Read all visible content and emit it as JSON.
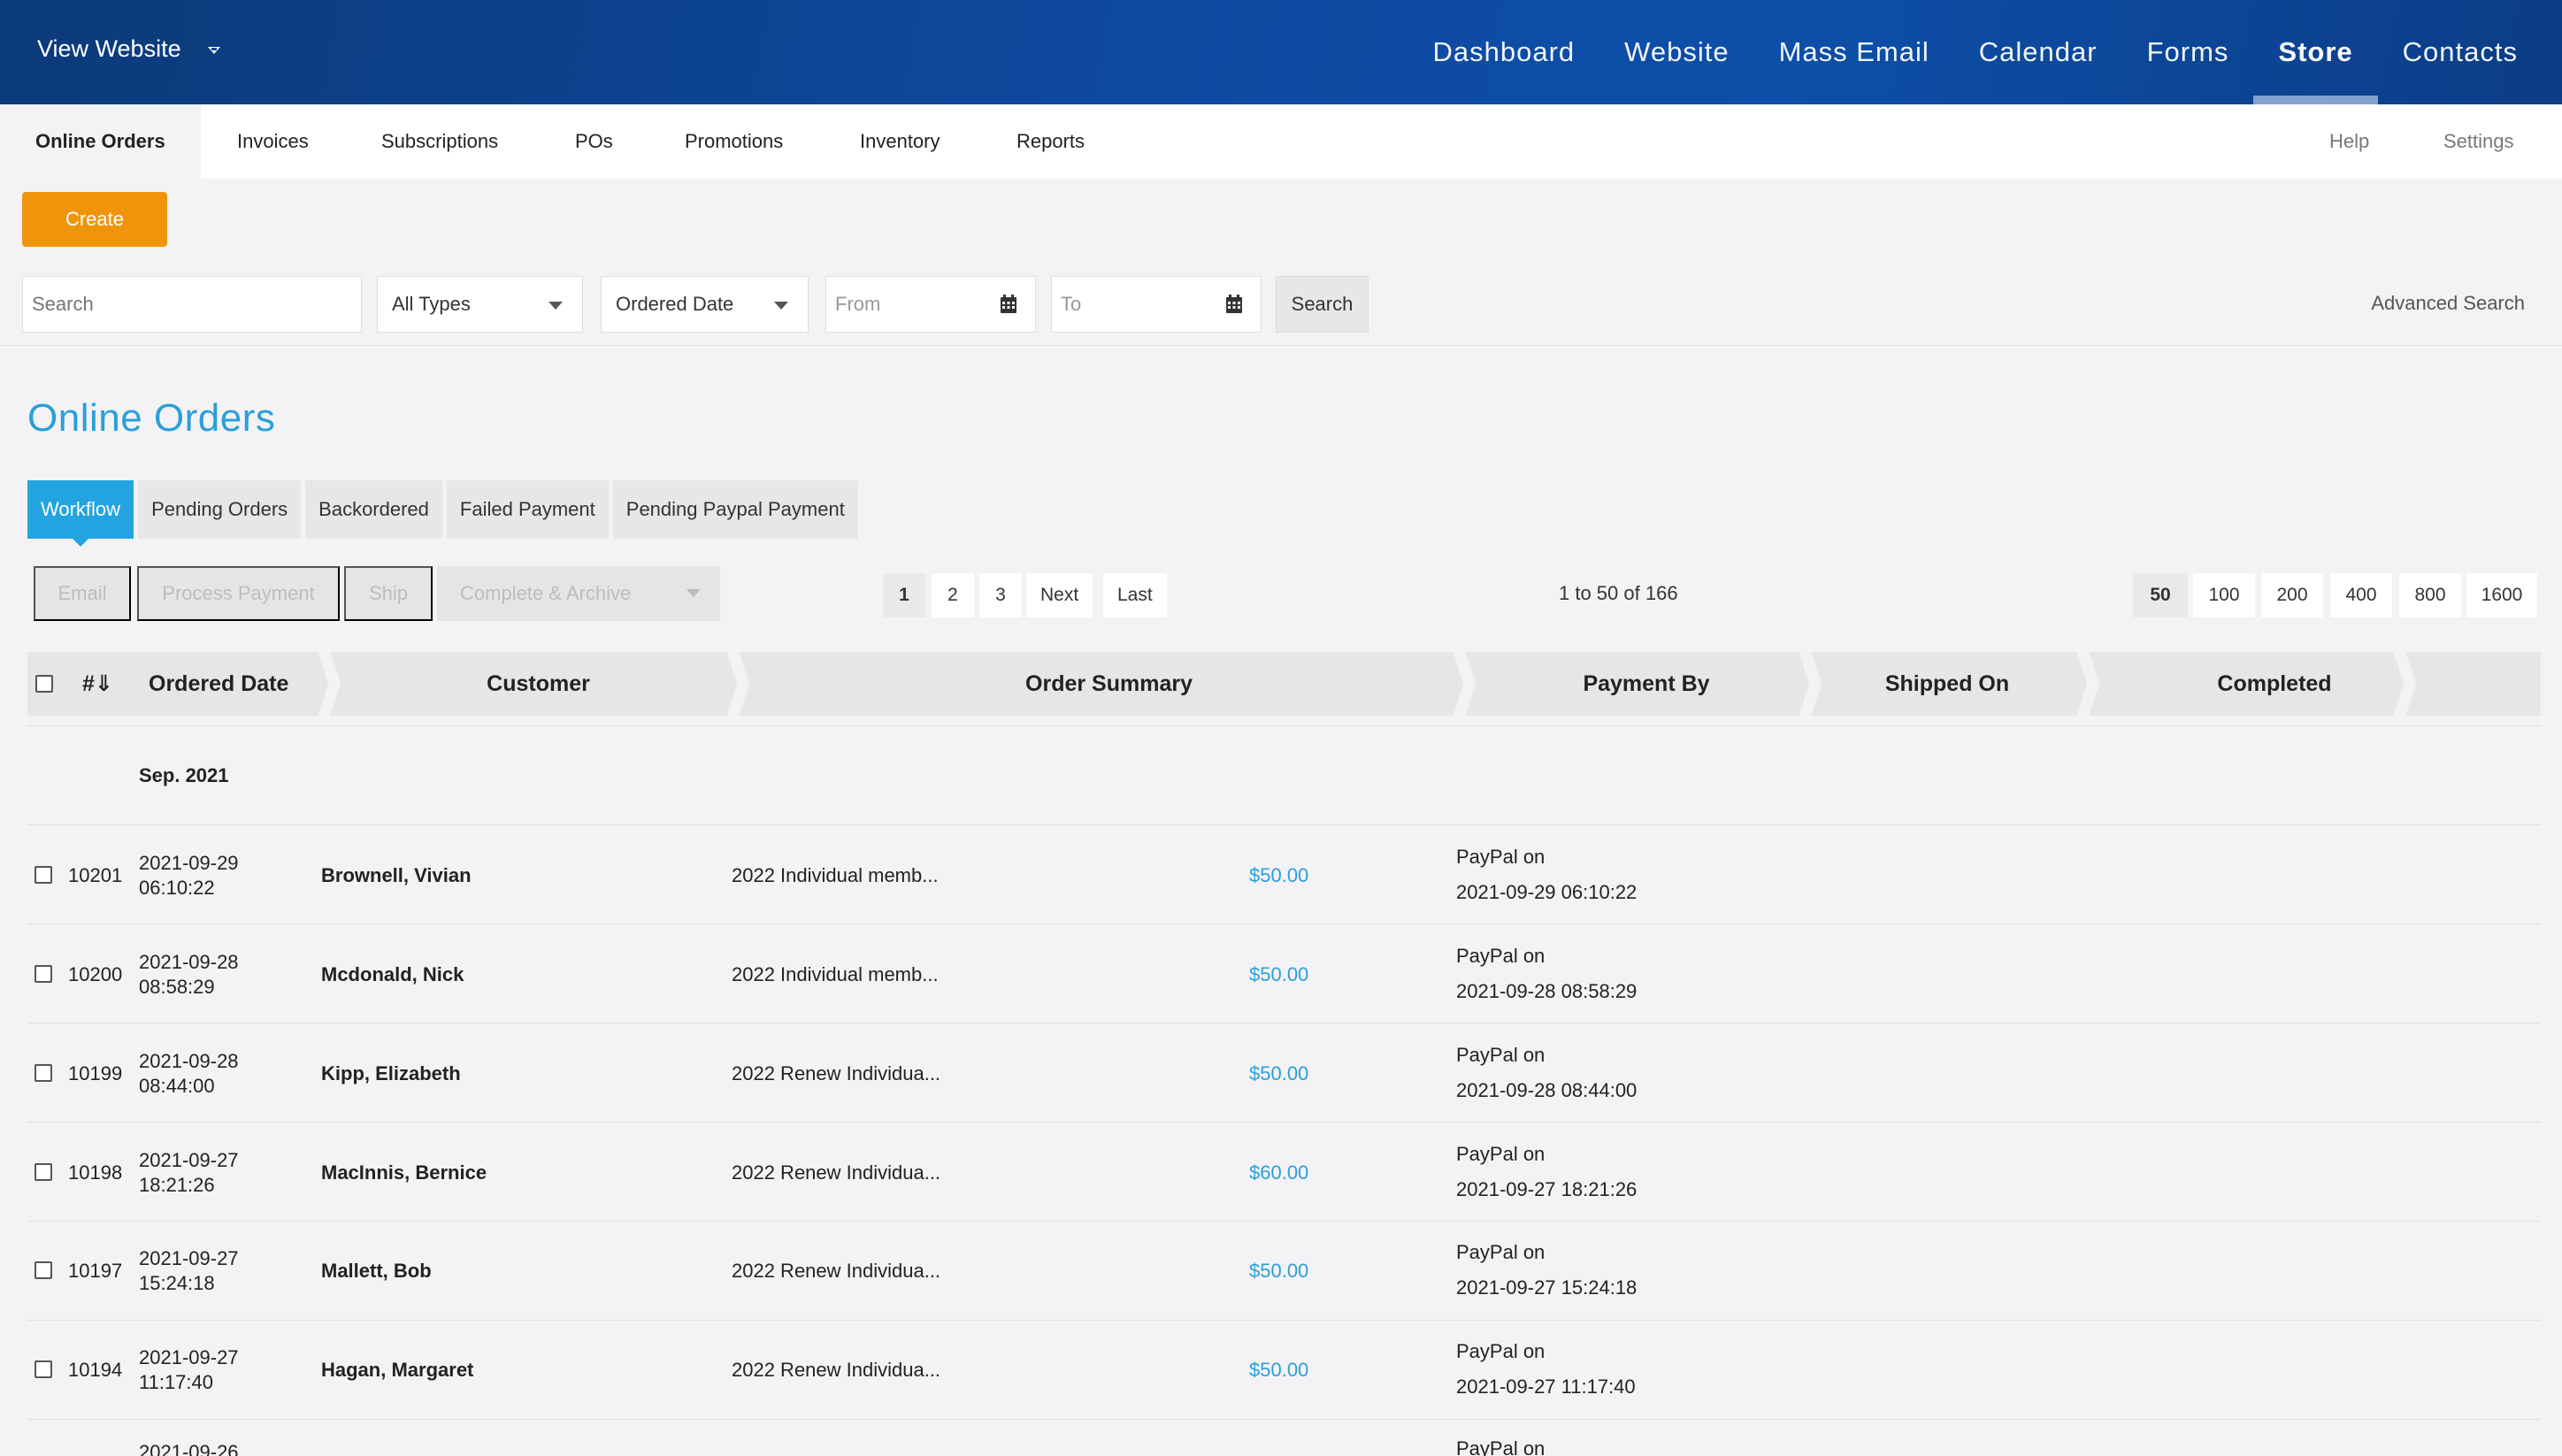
{
  "header": {
    "view_website": "View Website",
    "nav": [
      "Dashboard",
      "Website",
      "Mass Email",
      "Calendar",
      "Forms",
      "Store",
      "Contacts"
    ],
    "active_nav": "Store"
  },
  "subnav": {
    "items": [
      "Online Orders",
      "Invoices",
      "Subscriptions",
      "POs",
      "Promotions",
      "Inventory",
      "Reports"
    ],
    "active": "Online Orders",
    "help": "Help",
    "settings": "Settings"
  },
  "actions": {
    "create": "Create"
  },
  "filters": {
    "search_placeholder": "Search",
    "type_value": "All Types",
    "date_field_value": "Ordered Date",
    "from_placeholder": "From",
    "to_placeholder": "To",
    "search_button": "Search",
    "advanced_search": "Advanced Search"
  },
  "page_title": "Online Orders",
  "tabs": [
    "Workflow",
    "Pending Orders",
    "Backordered",
    "Failed Payment",
    "Pending Paypal Payment"
  ],
  "bulk_actions": [
    "Email",
    "Process Payment",
    "Ship",
    "Complete & Archive"
  ],
  "pagination": {
    "pages": [
      "1",
      "2",
      "3"
    ],
    "next": "Next",
    "last": "Last",
    "range": "1 to 50 of 166",
    "page_sizes": [
      "50",
      "100",
      "200",
      "400",
      "800",
      "1600"
    ]
  },
  "table": {
    "columns": {
      "number": "#⇓",
      "ordered_date": "Ordered Date",
      "customer": "Customer",
      "order_summary": "Order Summary",
      "payment_by": "Payment By",
      "shipped_on": "Shipped On",
      "completed": "Completed"
    },
    "group_label": "Sep. 2021",
    "rows": [
      {
        "id": "10201",
        "date": "2021-09-29",
        "time": "06:10:22",
        "customer": "Brownell, Vivian",
        "summary": "2022 Individual memb...",
        "amount": "$50.00",
        "payment_method": "PayPal on",
        "payment_date": "2021-09-29 06:10:22"
      },
      {
        "id": "10200",
        "date": "2021-09-28",
        "time": "08:58:29",
        "customer": "Mcdonald, Nick",
        "summary": "2022 Individual memb...",
        "amount": "$50.00",
        "payment_method": "PayPal on",
        "payment_date": "2021-09-28 08:58:29"
      },
      {
        "id": "10199",
        "date": "2021-09-28",
        "time": "08:44:00",
        "customer": "Kipp, Elizabeth",
        "summary": "2022 Renew Individua...",
        "amount": "$50.00",
        "payment_method": "PayPal on",
        "payment_date": "2021-09-28 08:44:00"
      },
      {
        "id": "10198",
        "date": "2021-09-27",
        "time": "18:21:26",
        "customer": "MacInnis, Bernice",
        "summary": "2022 Renew Individua...",
        "amount": "$60.00",
        "payment_method": "PayPal on",
        "payment_date": "2021-09-27 18:21:26"
      },
      {
        "id": "10197",
        "date": "2021-09-27",
        "time": "15:24:18",
        "customer": "Mallett, Bob",
        "summary": "2022 Renew Individua...",
        "amount": "$50.00",
        "payment_method": "PayPal on",
        "payment_date": "2021-09-27 15:24:18"
      },
      {
        "id": "10194",
        "date": "2021-09-27",
        "time": "11:17:40",
        "customer": "Hagan, Margaret",
        "summary": "2022 Renew Individua...",
        "amount": "$50.00",
        "payment_method": "PayPal on",
        "payment_date": "2021-09-27 11:17:40"
      },
      {
        "id": "",
        "date": "2021-09-26",
        "time": "",
        "customer": "",
        "summary": "",
        "amount": "",
        "payment_method": "PayPal on",
        "payment_date": ""
      }
    ]
  }
}
